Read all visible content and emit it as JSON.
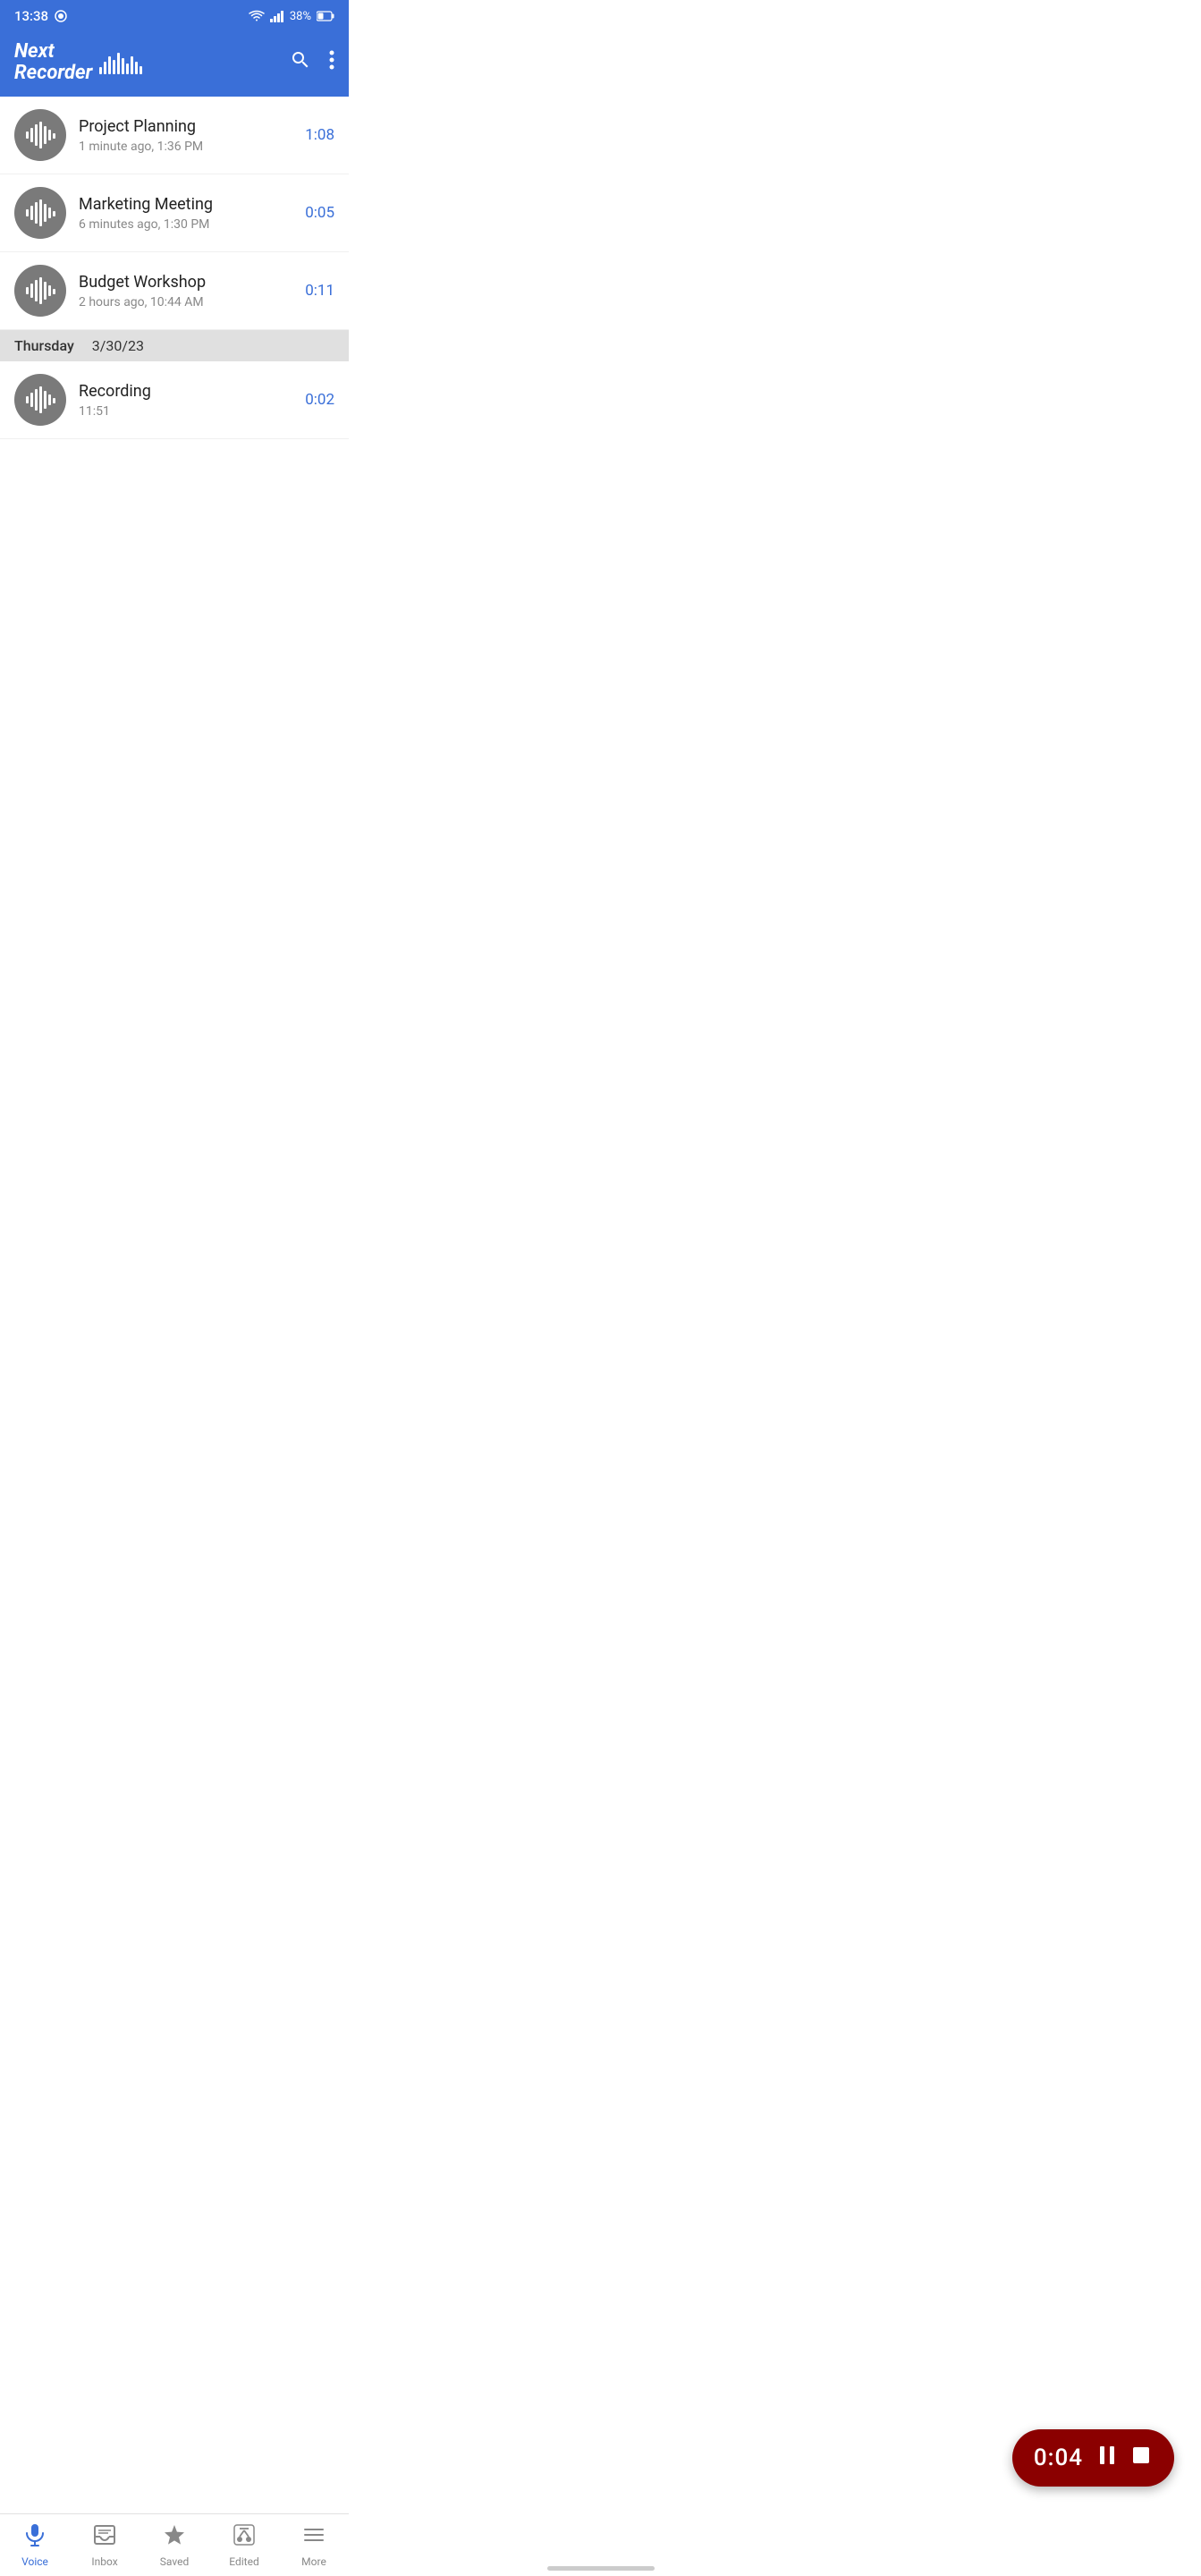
{
  "statusBar": {
    "time": "13:38",
    "battery": "38%"
  },
  "header": {
    "appName": "Next\nRecorder",
    "appNameLine1": "Next",
    "appNameLine2": "Recorder",
    "searchLabel": "search",
    "moreLabel": "more"
  },
  "recordings": [
    {
      "id": 1,
      "title": "Project Planning",
      "meta": "1 minute ago, 1:36 PM",
      "duration": "1:08"
    },
    {
      "id": 2,
      "title": "Marketing Meeting",
      "meta": "6 minutes ago, 1:30 PM",
      "duration": "0:05"
    },
    {
      "id": 3,
      "title": "Budget Workshop",
      "meta": "2 hours ago, 10:44 AM",
      "duration": "0:11"
    }
  ],
  "divider": {
    "day": "Thursday",
    "date": "3/30/23"
  },
  "olderRecordings": [
    {
      "id": 4,
      "title": "Recording",
      "meta": "11:51",
      "duration": "0:02"
    }
  ],
  "recordingFab": {
    "timer": "0:04"
  },
  "bottomNav": {
    "items": [
      {
        "id": "voice",
        "label": "Voice",
        "active": true
      },
      {
        "id": "inbox",
        "label": "Inbox",
        "active": false
      },
      {
        "id": "saved",
        "label": "Saved",
        "active": false
      },
      {
        "id": "edited",
        "label": "Edited",
        "active": false
      },
      {
        "id": "more",
        "label": "More",
        "active": false
      }
    ]
  },
  "colors": {
    "accent": "#3a6fd8",
    "recordingRed": "#8b0000",
    "avatarGray": "#7a7a7a"
  }
}
